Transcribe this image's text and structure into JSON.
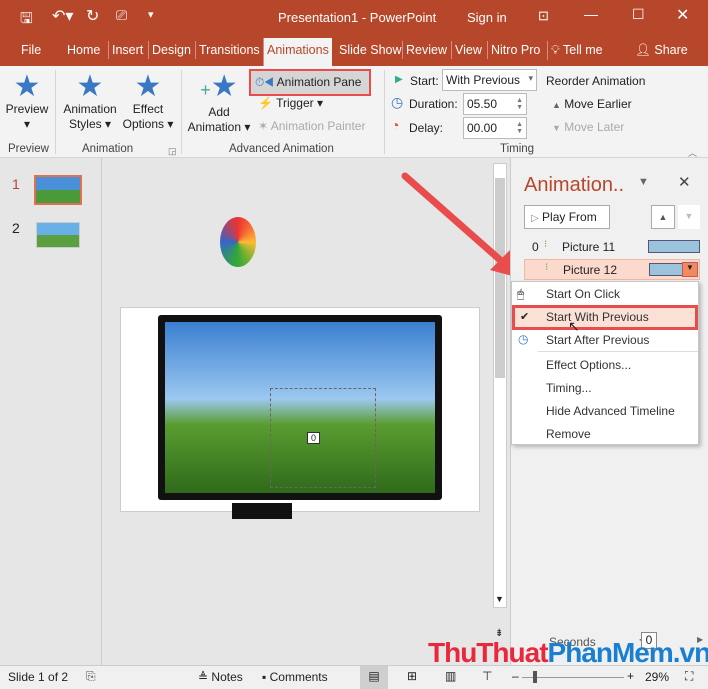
{
  "title": {
    "doc": "Presentation1  -  PowerPoint",
    "sign_in": "Sign in"
  },
  "tabs": [
    "File",
    "Home",
    "Insert",
    "Design",
    "Transitions",
    "Animations",
    "Slide Show",
    "Review",
    "View",
    "Nitro Pro",
    "Tell me",
    "Share"
  ],
  "ribbon": {
    "preview": "Preview",
    "animation_styles": [
      "Animation",
      "Styles"
    ],
    "effect_options": [
      "Effect",
      "Options"
    ],
    "add_animation": [
      "Add",
      "Animation"
    ],
    "animation_pane": "Animation Pane",
    "trigger": "Trigger",
    "animation_painter": "Animation Painter",
    "start_label": "Start:",
    "start_value": "With Previous",
    "duration_label": "Duration:",
    "duration_value": "05.50",
    "delay_label": "Delay:",
    "delay_value": "00.00",
    "reorder": "Reorder Animation",
    "move_earlier": "Move Earlier",
    "move_later": "Move Later",
    "groups": [
      "Preview",
      "Animation",
      "Advanced Animation",
      "Timing"
    ]
  },
  "slides": [
    "1",
    "2"
  ],
  "slide_marker": "0",
  "pane": {
    "title": "Animation..",
    "play_from": "Play From",
    "items": [
      {
        "index": "0",
        "name": "Picture 11"
      },
      {
        "index": "",
        "name": "Picture 12"
      }
    ],
    "seconds": "Seconds",
    "seconds_value": "0"
  },
  "menu": {
    "items": [
      "Start On Click",
      "Start With Previous",
      "Start After Previous",
      "Effect Options...",
      "Timing...",
      "Hide Advanced Timeline",
      "Remove"
    ]
  },
  "status": {
    "slide": "Slide 1 of 2",
    "notes": "Notes",
    "comments": "Comments",
    "zoom": "29%"
  },
  "watermark": "ThuThuatPhanMem.vn",
  "colors": {
    "accent": "#b7472a",
    "highlight": "#e84c4c"
  }
}
